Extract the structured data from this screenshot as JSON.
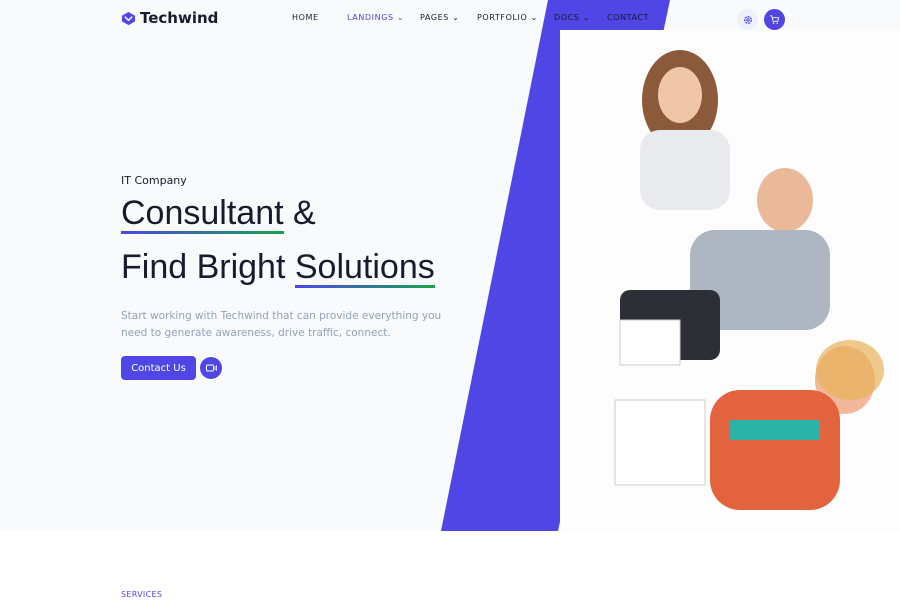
{
  "brand": {
    "name": "Techwind",
    "accent": "#4f46e5"
  },
  "nav": {
    "items": [
      {
        "label": "HOME",
        "dropdown": false,
        "active": false
      },
      {
        "label": "LANDINGS",
        "dropdown": true,
        "active": true
      },
      {
        "label": "PAGES",
        "dropdown": true,
        "active": false
      },
      {
        "label": "PORTFOLIO",
        "dropdown": true,
        "active": false
      },
      {
        "label": "DOCS",
        "dropdown": true,
        "active": false
      },
      {
        "label": "CONTACT",
        "dropdown": false,
        "active": false
      }
    ],
    "settings_icon": "gear-icon",
    "cart_icon": "cart-icon"
  },
  "hero": {
    "tag": "IT Company",
    "line1_a": "Consultant",
    "line1_b": " &",
    "line2_a": "Find Bright ",
    "line2_b": "Solutions",
    "description": "Start working with Techwind that can provide everything you need to generate awareness, drive traffic, connect.",
    "cta_label": "Contact Us",
    "video_icon": "video-icon"
  },
  "section": {
    "label": "SERVICES"
  }
}
